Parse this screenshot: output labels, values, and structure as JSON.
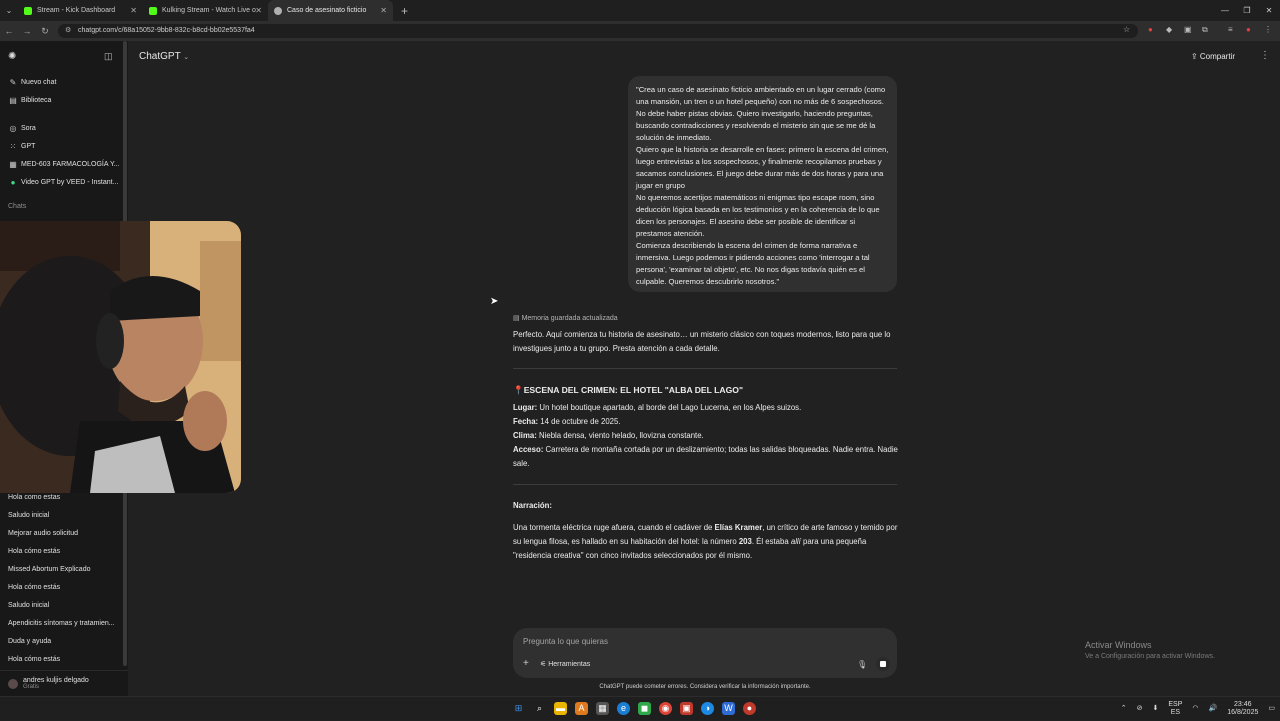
{
  "browser": {
    "tabs": [
      {
        "title": "Stream - Kick Dashboard",
        "color": "#53fc18"
      },
      {
        "title": "Kulking Stream - Watch Live o",
        "color": "#53fc18"
      },
      {
        "title": "Caso de asesinato ficticio",
        "color": "#b0b0b0"
      }
    ],
    "url": "chatgpt.com/c/68a15052-9bb8-832c-b8cd-bb02e5537fa4"
  },
  "sidebar": {
    "top_items": [
      {
        "icon": "new-chat-icon",
        "label": "Nuevo chat"
      },
      {
        "icon": "library-icon",
        "label": "Biblioteca"
      }
    ],
    "gpt_items": [
      {
        "icon": "sora-icon",
        "label": "Sora"
      },
      {
        "icon": "gpt-icon",
        "label": "GPT"
      },
      {
        "icon": "custom-gpt-icon",
        "label": "MED-603 FARMACOLOGÍA Y..."
      },
      {
        "icon": "veed-icon",
        "label": "Video GPT by VEED - Instant..."
      }
    ],
    "chats_label": "Chats",
    "chats": [
      "Hola como estas",
      "Saludo inicial",
      "Mejorar audio solicitud",
      "Hola cómo estás",
      "Missed Abortum Explicado",
      "Hola cómo estás",
      "Saludo inicial",
      "Apendicitis síntomas y tratamien...",
      "Duda y ayuda",
      "Hola cómo estás"
    ],
    "user": {
      "name": "andres kuljis delgado",
      "plan": "Gratis"
    }
  },
  "header": {
    "model": "ChatGPT",
    "share": "Compartir"
  },
  "conversation": {
    "user_message": [
      "\"Crea un caso de asesinato ficticio ambientado en un lugar cerrado (como una mansión, un tren o un hotel pequeño) con no más de 6 sospechosos. No debe haber pistas obvias. Quiero investigarlo, haciendo preguntas, buscando contradicciones y resolviendo el misterio sin que se me dé la solución de inmediato.",
      "Quiero que la historia se desarrolle en fases: primero la escena del crimen, luego entrevistas a los sospechosos, y finalmente recopilamos pruebas y sacamos conclusiones. El juego debe durar más de dos horas y para una jugar en grupo",
      "No queremos acertijos matemáticos ni enigmas tipo escape room, sino deducción lógica basada en los testimonios y en la coherencia de lo que dicen los personajes. El asesino debe ser posible de identificar si prestamos atención.",
      "Comienza describiendo la escena del crimen de forma narrativa e inmersiva. Luego podemos ir pidiendo acciones como 'interrogar a tal persona', 'examinar tal objeto', etc. No nos digas todavía quién es el culpable. Queremos descubrirlo nosotros.\""
    ],
    "memory_note": "Memoria guardada actualizada",
    "intro": "Perfecto. Aquí comienza tu historia de asesinato… un misterio clásico con toques modernos, listo para que lo investigues junto a tu grupo. Presta atención a cada detalle.",
    "scene_title": "ESCENA DEL CRIMEN: EL HOTEL \"ALBA DEL LAGO\"",
    "facts": [
      {
        "label": "Lugar:",
        "value": " Un hotel boutique apartado, al borde del Lago Lucerna, en los Alpes suizos."
      },
      {
        "label": "Fecha:",
        "value": " 14 de octubre de 2025."
      },
      {
        "label": "Clima:",
        "value": " Niebla densa, viento helado, llovizna constante."
      },
      {
        "label": "Acceso:",
        "value": " Carretera de montaña cortada por un deslizamiento; todas las salidas bloqueadas. Nadie entra. Nadie sale."
      }
    ],
    "narration_label": "Narración:",
    "narration_parts": [
      "Una tormenta eléctrica ruge afuera, cuando el cadáver de ",
      "Elías Kramer",
      ", un crítico de arte famoso y temido por su lengua filosa, es hallado en su habitación del hotel: la número ",
      "203",
      ". Él estaba ",
      "allí",
      " para una pequeña \"residencia creativa\" con cinco invitados seleccionados por él mismo."
    ]
  },
  "composer": {
    "placeholder": "Pregunta lo que quieras",
    "tools": "Herramientas",
    "disclaimer": "ChatGPT puede cometer errores. Considera verificar la información importante."
  },
  "watermark": {
    "title": "Activar Windows",
    "subtitle": "Ve a Configuración para activar Windows."
  },
  "taskbar": {
    "lang": "ESP",
    "lang_sub": "ES",
    "time": "23:46",
    "date": "16/8/2025"
  }
}
